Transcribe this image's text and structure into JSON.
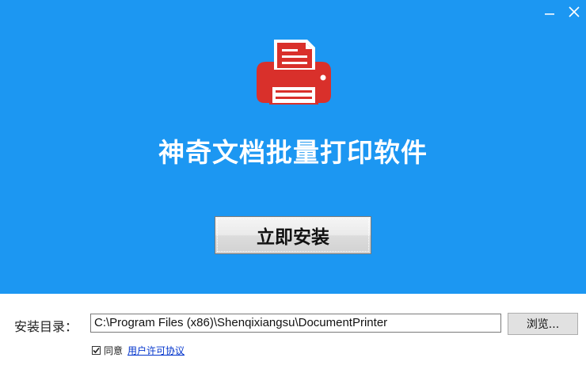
{
  "window": {
    "minimize_icon": "minimize-icon",
    "close_icon": "close-icon"
  },
  "banner": {
    "background_color": "#1c97f2",
    "logo_icon": "printer-icon",
    "logo_color": "#d9302b",
    "title": "神奇文档批量打印软件"
  },
  "install": {
    "button_label": "立即安装"
  },
  "directory": {
    "label": "安装目录：",
    "value": "C:\\Program Files (x86)\\Shenqixiangsu\\DocumentPrinter",
    "browse_label": "浏览..."
  },
  "agreement": {
    "checked": true,
    "label": "同意",
    "link_text": "用户许可协议"
  }
}
